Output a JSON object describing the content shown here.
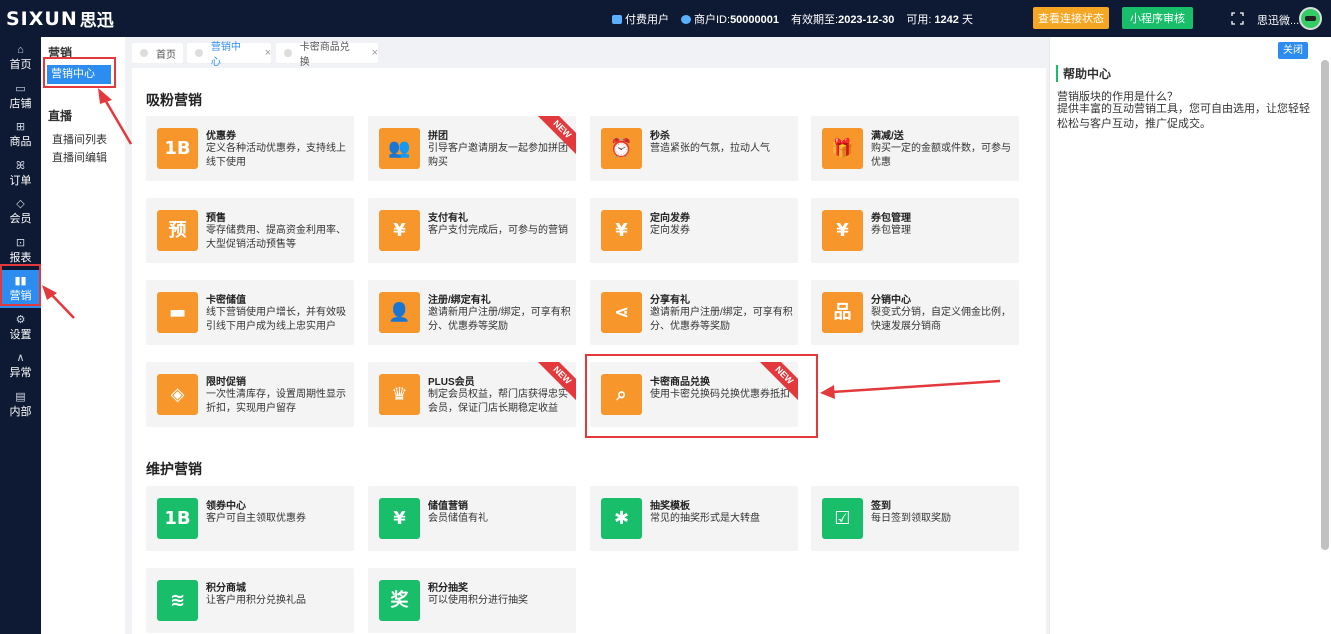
{
  "brand": {
    "en": "SIXUN",
    "cn": "思迅"
  },
  "topbar": {
    "user_type": "付费用户",
    "merchant_label": "商户ID:",
    "merchant_id": "50000001",
    "valid_label": "有效期至:",
    "valid_date": "2023-12-30",
    "available_label": "可用:",
    "available_days": "1242",
    "days_unit": "天",
    "status_button": "查看连接状态",
    "audit_button": "小程序审核",
    "user_name": "思迅微..."
  },
  "leftnav": [
    {
      "label": "首页",
      "icon": "home-icon",
      "glyph": "⌂"
    },
    {
      "label": "店铺",
      "icon": "store-icon",
      "glyph": "▭"
    },
    {
      "label": "商品",
      "icon": "gift-icon",
      "glyph": "⊞"
    },
    {
      "label": "订单",
      "icon": "order-icon",
      "glyph": "ꕤ"
    },
    {
      "label": "会员",
      "icon": "member-icon",
      "glyph": "◇"
    },
    {
      "label": "报表",
      "icon": "report-icon",
      "glyph": "⊡"
    },
    {
      "label": "营销",
      "icon": "marketing-icon",
      "glyph": "▮▮",
      "active": true
    },
    {
      "label": "设置",
      "icon": "settings-icon",
      "glyph": "⚙"
    },
    {
      "label": "异常",
      "icon": "exception-icon",
      "glyph": "∧"
    },
    {
      "label": "内部",
      "icon": "internal-icon",
      "glyph": "▤"
    }
  ],
  "subnav": {
    "group1": "营销",
    "active_item": "营销中心",
    "group2": "直播",
    "items": [
      "直播间列表",
      "直播间编辑"
    ]
  },
  "tabs": [
    {
      "label": "首页"
    },
    {
      "label": "营销中心",
      "active": true
    },
    {
      "label": "卡密商品兑换"
    }
  ],
  "sections": {
    "attract": "吸粉营销",
    "maintain": "维护营销"
  },
  "cards_attract": [
    {
      "title": "优惠券",
      "desc": "定义各种活动优惠券，支持线上线下使用",
      "icon": "coupon-icon",
      "glyph": "1B"
    },
    {
      "title": "拼团",
      "desc": "引导客户邀请朋友一起参加拼团购买",
      "icon": "group-buy-icon",
      "glyph": "👥",
      "badge": "NEW"
    },
    {
      "title": "秒杀",
      "desc": "营造紧张的气氛，拉动人气",
      "icon": "alarm-clock-icon",
      "glyph": "⏰"
    },
    {
      "title": "满减/送",
      "desc": "购买一定的金额或件数，可参与优惠",
      "icon": "gift-box-icon",
      "glyph": "🎁"
    },
    {
      "title": "预售",
      "desc": "零存储费用、提高资金利用率、大型促销活动预售等",
      "icon": "presale-icon",
      "glyph": "预"
    },
    {
      "title": "支付有礼",
      "desc": "客户支付完成后，可参与的营销",
      "icon": "pay-gift-icon",
      "glyph": "¥"
    },
    {
      "title": "定向发券",
      "desc": "定向发券",
      "icon": "targeted-coupon-icon",
      "glyph": "¥"
    },
    {
      "title": "券包管理",
      "desc": "券包管理",
      "icon": "coupon-pack-icon",
      "glyph": "¥"
    },
    {
      "title": "卡密储值",
      "desc": "线下营销使用户增长，并有效吸引线下用户成为线上忠实用户",
      "icon": "card-icon",
      "glyph": "▬"
    },
    {
      "title": "注册/绑定有礼",
      "desc": "邀请新用户注册/绑定，可享有积分、优惠券等奖励",
      "icon": "register-icon",
      "glyph": "👤"
    },
    {
      "title": "分享有礼",
      "desc": "邀请新用户注册/绑定，可享有积分、优惠券等奖励",
      "icon": "share-icon",
      "glyph": "⋖"
    },
    {
      "title": "分销中心",
      "desc": "裂变式分销，自定义佣金比例，快速发展分销商",
      "icon": "distribution-icon",
      "glyph": "品"
    },
    {
      "title": "限时促销",
      "desc": "一次性清库存，设置周期性显示折扣，实现用户留存",
      "icon": "tag-icon",
      "glyph": "◈"
    },
    {
      "title": "PLUS会员",
      "desc": "制定会员权益，帮门店获得忠实会员，保证门店长期稳定收益",
      "icon": "crown-icon",
      "glyph": "♛",
      "badge": "NEW"
    },
    {
      "title": "卡密商品兑换",
      "desc": "使用卡密兑换码兑换优惠券抵扣",
      "icon": "card-redeem-icon",
      "glyph": "⌕",
      "badge": "NEW"
    }
  ],
  "cards_maintain": [
    {
      "title": "领券中心",
      "desc": "客户可自主领取优惠券",
      "icon": "coupon-center-icon",
      "glyph": "1B"
    },
    {
      "title": "储值营销",
      "desc": "会员储值有礼",
      "icon": "piggy-bank-icon",
      "glyph": "¥"
    },
    {
      "title": "抽奖模板",
      "desc": "常见的抽奖形式是大转盘",
      "icon": "wheel-icon",
      "glyph": "✱"
    },
    {
      "title": "签到",
      "desc": "每日签到领取奖励",
      "icon": "checkin-icon",
      "glyph": "☑"
    },
    {
      "title": "积分商城",
      "desc": "让客户用积分兑换礼品",
      "icon": "points-mall-icon",
      "glyph": "≋"
    },
    {
      "title": "积分抽奖",
      "desc": "可以使用积分进行抽奖",
      "icon": "points-lottery-icon",
      "glyph": "奖"
    }
  ],
  "help": {
    "close": "关闭",
    "title": "帮助中心",
    "question": "营销版块的作用是什么？",
    "answer": "提供丰富的互动营销工具，您可自由选用，让您轻轻松松与客户互动，推广促成交。"
  },
  "colors": {
    "orange": "#f7962a",
    "green": "#19be6b",
    "blue": "#2d8cf0",
    "red": "#e4393c",
    "navy": "#0e1a33"
  }
}
